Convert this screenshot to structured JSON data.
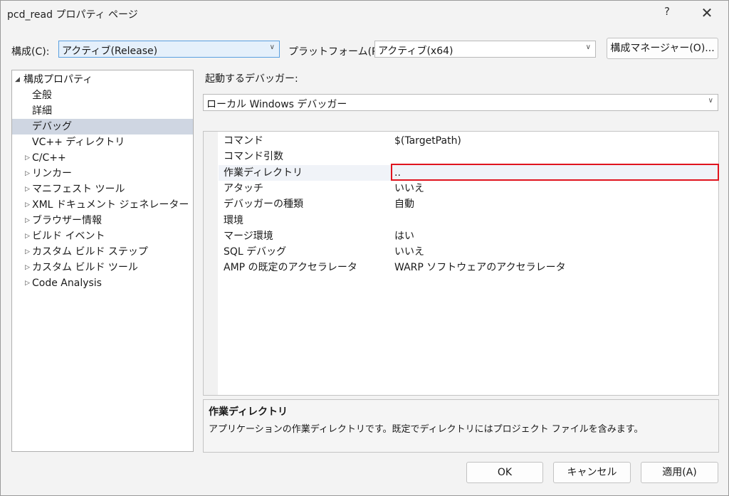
{
  "window": {
    "title": "pcd_read プロパティ ページ",
    "help_glyph": "?",
    "close_glyph": "✕"
  },
  "toolbar": {
    "config_label": "構成(C):",
    "config_value": "アクティブ(Release)",
    "platform_label": "プラットフォーム(P):",
    "platform_value": "アクティブ(x64)",
    "config_manager_label": "構成マネージャー(O)..."
  },
  "tree": {
    "root": "構成プロパティ",
    "items": [
      {
        "label": "全般",
        "expandable": false
      },
      {
        "label": "詳細",
        "expandable": false
      },
      {
        "label": "デバッグ",
        "expandable": false,
        "selected": true
      },
      {
        "label": "VC++ ディレクトリ",
        "expandable": false
      },
      {
        "label": "C/C++",
        "expandable": true
      },
      {
        "label": "リンカー",
        "expandable": true
      },
      {
        "label": "マニフェスト ツール",
        "expandable": true
      },
      {
        "label": "XML ドキュメント ジェネレーター",
        "expandable": true
      },
      {
        "label": "ブラウザー情報",
        "expandable": true
      },
      {
        "label": "ビルド イベント",
        "expandable": true
      },
      {
        "label": "カスタム ビルド ステップ",
        "expandable": true
      },
      {
        "label": "カスタム ビルド ツール",
        "expandable": true
      },
      {
        "label": "Code Analysis",
        "expandable": true
      }
    ]
  },
  "debugger": {
    "label": "起動するデバッガー:",
    "value": "ローカル Windows デバッガー"
  },
  "properties": [
    {
      "name": "コマンド",
      "value": "$(TargetPath)"
    },
    {
      "name": "コマンド引数",
      "value": ""
    },
    {
      "name": "作業ディレクトリ",
      "value": "..",
      "highlighted": true
    },
    {
      "name": "アタッチ",
      "value": "いいえ"
    },
    {
      "name": "デバッガーの種類",
      "value": "自動"
    },
    {
      "name": "環境",
      "value": ""
    },
    {
      "name": "マージ環境",
      "value": "はい"
    },
    {
      "name": "SQL デバッグ",
      "value": "いいえ"
    },
    {
      "name": "AMP の既定のアクセラレータ",
      "value": "WARP ソフトウェアのアクセラレータ"
    }
  ],
  "description": {
    "title": "作業ディレクトリ",
    "text": "アプリケーションの作業ディレクトリです。既定でディレクトリにはプロジェクト ファイルを含みます。"
  },
  "buttons": {
    "ok": "OK",
    "cancel": "キャンセル",
    "apply": "適用(A)"
  },
  "colors": {
    "selection": "#cfd6e2",
    "annotation_box": "#e0141e",
    "focus_combo": "#e5f0fb"
  }
}
